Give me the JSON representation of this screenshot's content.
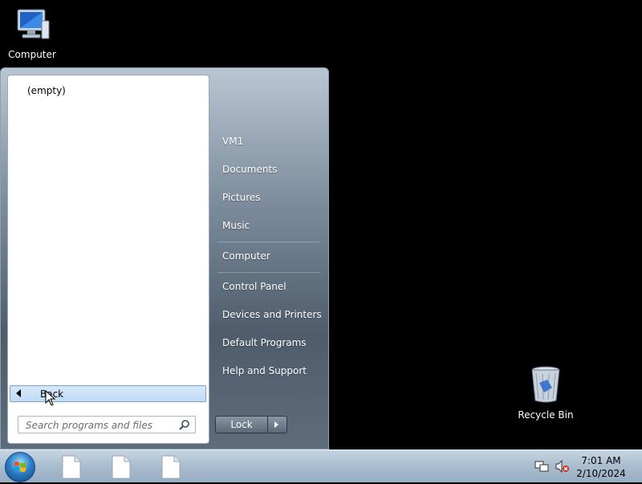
{
  "desktop": {
    "icons": [
      {
        "label": "Computer"
      },
      {
        "label": "Recycle Bin"
      }
    ]
  },
  "start_menu": {
    "programs_list": {
      "empty_text": "(empty)",
      "back_label": "Back"
    },
    "search": {
      "placeholder": "Search programs and files"
    },
    "right_items": [
      {
        "label": "VM1"
      },
      {
        "label": "Documents"
      },
      {
        "label": "Pictures"
      },
      {
        "label": "Music"
      },
      {
        "label": "Computer"
      },
      {
        "label": "Control Panel"
      },
      {
        "label": "Devices and Printers"
      },
      {
        "label": "Default Programs"
      },
      {
        "label": "Help and Support"
      }
    ],
    "lock_label": "Lock"
  },
  "taskbar": {
    "pinned": [
      "file-icon",
      "file-icon",
      "file-icon"
    ],
    "clock": {
      "time": "7:01 AM",
      "date": "2/10/2024"
    }
  }
}
